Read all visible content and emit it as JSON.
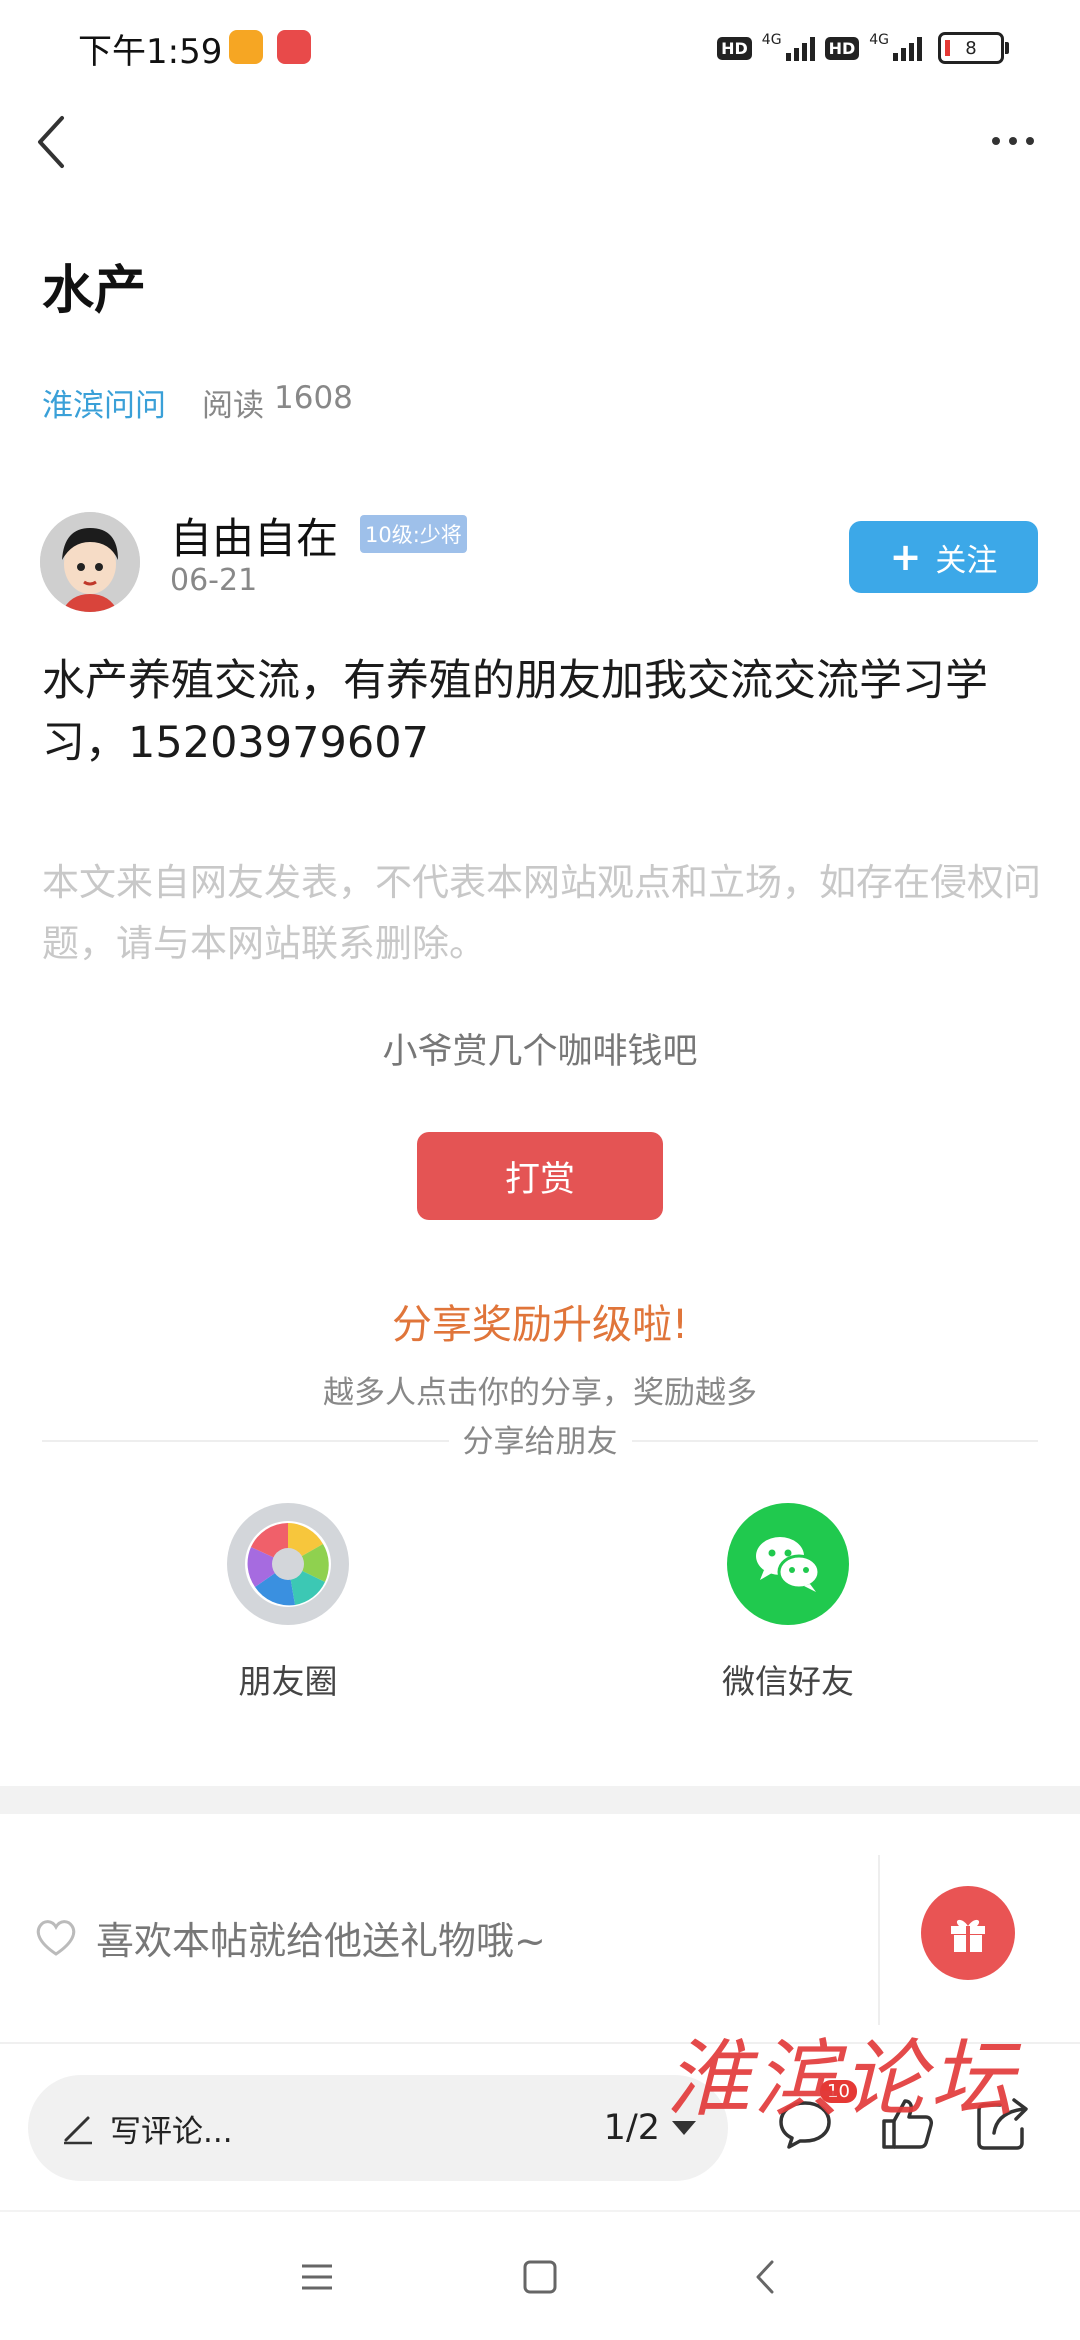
{
  "status_bar": {
    "time": "下午1:59",
    "hd_badge": "HD",
    "network_label": "4G",
    "battery": "8"
  },
  "post": {
    "title": "水产",
    "forum": "淮滨问问",
    "read_count_label": "阅读",
    "read_count": "1608",
    "body": "水产养殖交流，有养殖的朋友加我交流交流学习学习，15203979607",
    "disclaimer": "本文来自网友发表，不代表本网站观点和立场，如存在侵权问题，请与本网站联系删除。"
  },
  "author": {
    "name": "自由自在",
    "level": "10级:少将",
    "date": "06-21",
    "follow_label": "关注",
    "follow_plus": "+"
  },
  "reward": {
    "prompt": "小爷赏几个咖啡钱吧",
    "button": "打赏"
  },
  "share": {
    "title": "分享奖励升级啦!",
    "subtitle": "越多人点击你的分享，奖励越多",
    "friends_label": "分享给朋友",
    "items": [
      {
        "label": "朋友圈",
        "icon": "moments-icon"
      },
      {
        "label": "微信好友",
        "icon": "wechat-icon"
      }
    ]
  },
  "gift": {
    "prompt": "喜欢本帖就给他送礼物哦~"
  },
  "watermark": "淮滨论坛",
  "bottom_bar": {
    "comment_placeholder": "写评论...",
    "page_indicator": "1/2",
    "comment_count": "10"
  },
  "colors": {
    "accent_blue": "#3ca8e8",
    "reward_red": "#e45454",
    "share_orange": "#e0753a",
    "wechat_green": "#20c94e"
  }
}
